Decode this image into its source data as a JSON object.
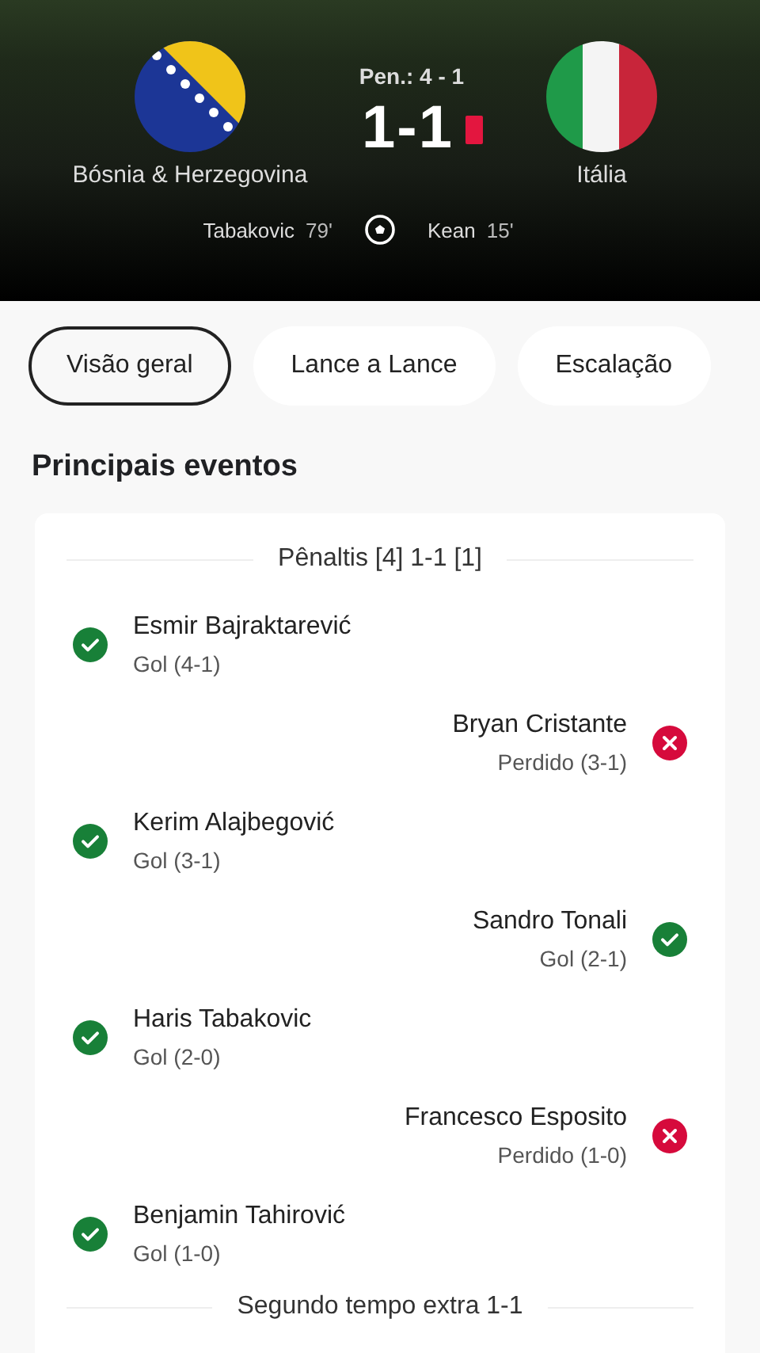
{
  "match": {
    "penalties": "Pen.: 4 - 1",
    "score": "1-1",
    "red_card": true,
    "teams": [
      {
        "name": "Bósnia & Herzegovina",
        "kind": "bosnia"
      },
      {
        "name": "Itália",
        "kind": "italy"
      }
    ],
    "home_scorers": [
      {
        "name": "Tabakovic",
        "minute": "79'"
      }
    ],
    "away_scorers": [
      {
        "name": "Kean",
        "minute": "15'"
      }
    ]
  },
  "tabs": [
    {
      "label": "Visão geral",
      "selected": true
    },
    {
      "label": "Lance a Lance",
      "selected": false
    },
    {
      "label": "Escalação",
      "selected": false
    }
  ],
  "section_title": "Principais eventos",
  "groups": [
    {
      "title": "Pênaltis [4] 1-1 [1]",
      "events": [
        {
          "home": true,
          "kind": "scored",
          "player": "Esmir Bajraktarević",
          "detail": "Gol (4-1)"
        },
        {
          "home": false,
          "kind": "missed",
          "player": "Bryan Cristante",
          "detail": "Perdido (3-1)"
        },
        {
          "home": true,
          "kind": "scored",
          "player": "Kerim Alajbegović",
          "detail": "Gol (3-1)"
        },
        {
          "home": false,
          "kind": "scored",
          "player": "Sandro Tonali",
          "detail": "Gol (2-1)"
        },
        {
          "home": true,
          "kind": "scored",
          "player": "Haris Tabakovic",
          "detail": "Gol (2-0)"
        },
        {
          "home": false,
          "kind": "missed",
          "player": "Francesco Esposito",
          "detail": "Perdido (1-0)"
        },
        {
          "home": true,
          "kind": "scored",
          "player": "Benjamin Tahirović",
          "detail": "Gol (1-0)"
        }
      ]
    },
    {
      "title": "Segundo tempo extra 1-1"
    }
  ]
}
